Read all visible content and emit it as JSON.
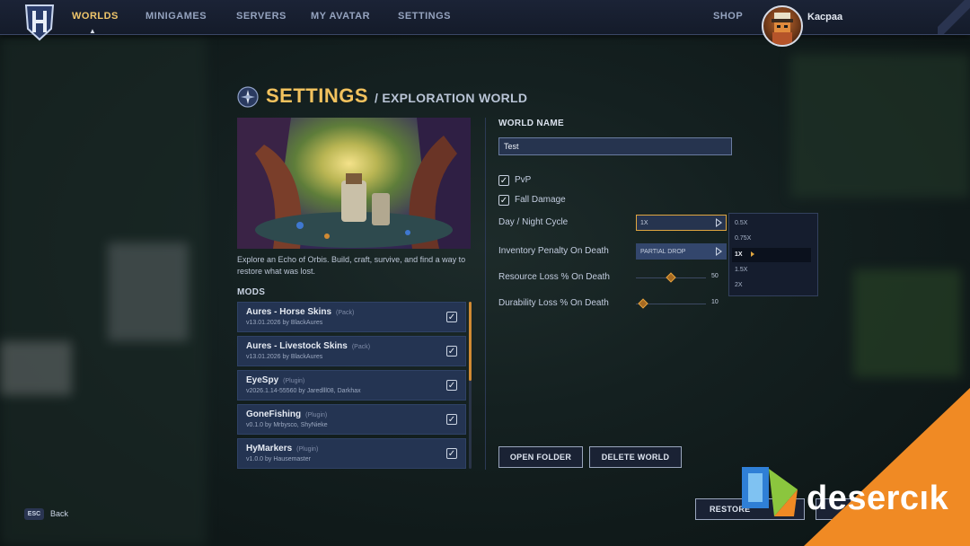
{
  "nav": {
    "items": [
      {
        "label": "WORLDS",
        "active": true
      },
      {
        "label": "MINIGAMES"
      },
      {
        "label": "SERVERS"
      },
      {
        "label": "MY AVATAR"
      },
      {
        "label": "SETTINGS"
      }
    ],
    "shop": "SHOP",
    "username": "Kacpaa"
  },
  "page": {
    "title": "SETTINGS",
    "subtitle": "/ EXPLORATION WORLD",
    "description": "Explore an Echo of Orbis. Build, craft, survive, and find a way to restore what was lost.",
    "mods_label": "MODS"
  },
  "mods": [
    {
      "name": "Aures - Horse Skins",
      "type": "(Pack)",
      "version": "v13.01.2026 by BlackAures",
      "enabled": true
    },
    {
      "name": "Aures - Livestock Skins",
      "type": "(Pack)",
      "version": "v13.01.2026 by BlackAures",
      "enabled": true
    },
    {
      "name": "EyeSpy",
      "type": "(Plugin)",
      "version": "v2026.1.14-55560 by Jaredlll08, Darkhax",
      "enabled": true
    },
    {
      "name": "GoneFishing",
      "type": "(Plugin)",
      "version": "v0.1.0 by Mrbysco, ShyNieke",
      "enabled": true
    },
    {
      "name": "HyMarkers",
      "type": "(Plugin)",
      "version": "v1.0.0 by Hausemaster",
      "enabled": true
    }
  ],
  "settings": {
    "world_name_label": "WORLD NAME",
    "world_name_value": "Test",
    "pvp_label": "PvP",
    "pvp": true,
    "fall_damage_label": "Fall Damage",
    "fall_damage": true,
    "day_night_label": "Day / Night Cycle",
    "day_night_value": "1X",
    "day_night_options": [
      "0.5X",
      "0.75X",
      "1X",
      "1.5X",
      "2X"
    ],
    "inventory_penalty_label": "Inventory Penalty On Death",
    "inventory_penalty_value": "PARTIAL DROP",
    "resource_loss_label": "Resource Loss % On Death",
    "resource_loss_value": 50,
    "durability_loss_label": "Durability Loss % On Death",
    "durability_loss_value": 10
  },
  "buttons": {
    "open_folder": "OPEN FOLDER",
    "delete_world": "DELETE WORLD",
    "restore": "RESTORE"
  },
  "footer": {
    "esc_key": "ESC",
    "back": "Back"
  },
  "watermark": "desercık",
  "colors": {
    "accent": "#f2c25e",
    "panel": "#243452",
    "slider": "#e4a23e",
    "watermark_orange": "#f08a24"
  }
}
